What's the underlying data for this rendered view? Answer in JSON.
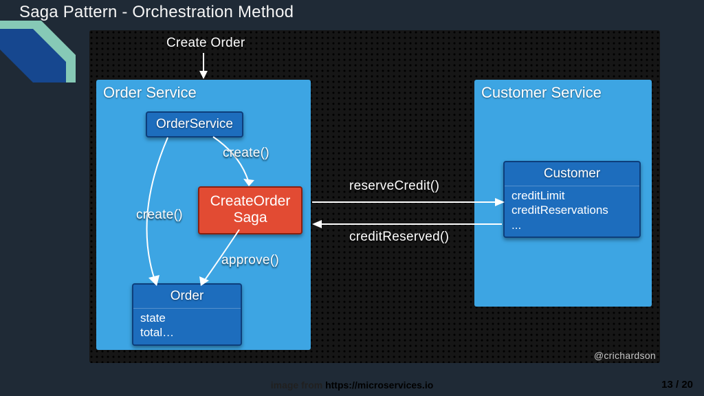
{
  "title": "Saga Pattern - Orchestration Method",
  "footer": {
    "prefix": "image from ",
    "link": "https://microservices.io"
  },
  "pager": {
    "current": "13",
    "sep": " / ",
    "total": "20"
  },
  "credit": "@crichardson",
  "diagram": {
    "top_label": "Create Order",
    "order_service": {
      "title": "Order Service",
      "order_service_box": "OrderService",
      "create_label_1": "create()",
      "create_label_2": "create()",
      "approve_label": "approve()",
      "saga_box_line1": "CreateOrder",
      "saga_box_line2": "Saga",
      "order_box": "Order",
      "order_attr1": "state",
      "order_attr2": "total…"
    },
    "msg_reserve": "reserveCredit()",
    "msg_reserved": "creditReserved()",
    "customer_service": {
      "title": "Customer Service",
      "customer_box": "Customer",
      "cust_attr1": "creditLimit",
      "cust_attr2": "creditReservations",
      "cust_attr3": "..."
    }
  }
}
